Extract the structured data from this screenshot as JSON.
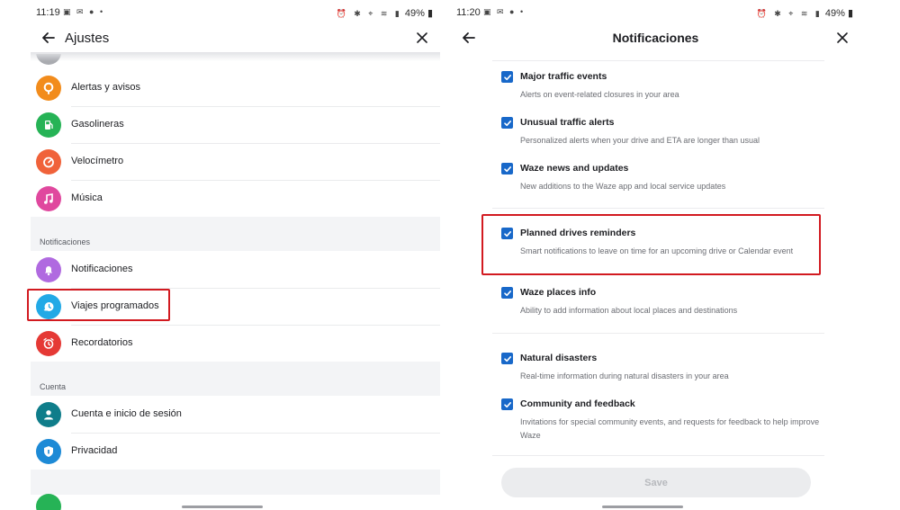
{
  "left": {
    "status": {
      "time": "11:19",
      "battery": "49%"
    },
    "title": "Ajustes",
    "items_top": [
      {
        "label": "Alertas y avisos",
        "icon": "alert-pin-icon",
        "color": "#f28c1c"
      },
      {
        "label": "Gasolineras",
        "icon": "fuel-icon",
        "color": "#26b356"
      },
      {
        "label": "Velocímetro",
        "icon": "speedometer-icon",
        "color": "#f0623a"
      },
      {
        "label": "Música",
        "icon": "music-note-icon",
        "color": "#e0489e"
      }
    ],
    "section_notifications": "Notificaciones",
    "items_notifications": [
      {
        "label": "Notificaciones",
        "icon": "bell-icon",
        "color": "#b06ae0"
      },
      {
        "label": "Viajes programados",
        "icon": "planned-drive-icon",
        "color": "#22a9e6"
      },
      {
        "label": "Recordatorios",
        "icon": "alarm-clock-icon",
        "color": "#e53935"
      }
    ],
    "section_account": "Cuenta",
    "items_account": [
      {
        "label": "Cuenta e inicio de sesión",
        "icon": "account-icon",
        "color": "#0f7d8a"
      },
      {
        "label": "Privacidad",
        "icon": "privacy-shield-icon",
        "color": "#1d8ad6"
      }
    ]
  },
  "right": {
    "status": {
      "time": "11:20",
      "battery": "49%"
    },
    "title": "Notificaciones",
    "items": [
      {
        "title": "Major traffic events",
        "desc": "Alerts on event-related closures in your area",
        "checked": true
      },
      {
        "title": "Unusual traffic alerts",
        "desc": "Personalized alerts when your drive and ETA are longer than usual",
        "checked": true
      },
      {
        "title": "Waze news and updates",
        "desc": "New additions to the Waze app and local service updates",
        "checked": true
      },
      {
        "title": "Planned drives reminders",
        "desc": "Smart notifications to leave on time for an upcoming drive or Calendar event",
        "checked": true
      },
      {
        "title": "Waze places info",
        "desc": "Ability to add information about local places and destinations",
        "checked": true
      },
      {
        "title": "Natural disasters",
        "desc": "Real-time information during natural disasters in your area",
        "checked": true
      },
      {
        "title": "Community and feedback",
        "desc": "Invitations for special community events, and requests for feedback to help improve Waze",
        "checked": true
      }
    ],
    "save_label": "Save"
  },
  "colors": {
    "highlight": "#d21a20",
    "checkbox": "#1868c9"
  }
}
